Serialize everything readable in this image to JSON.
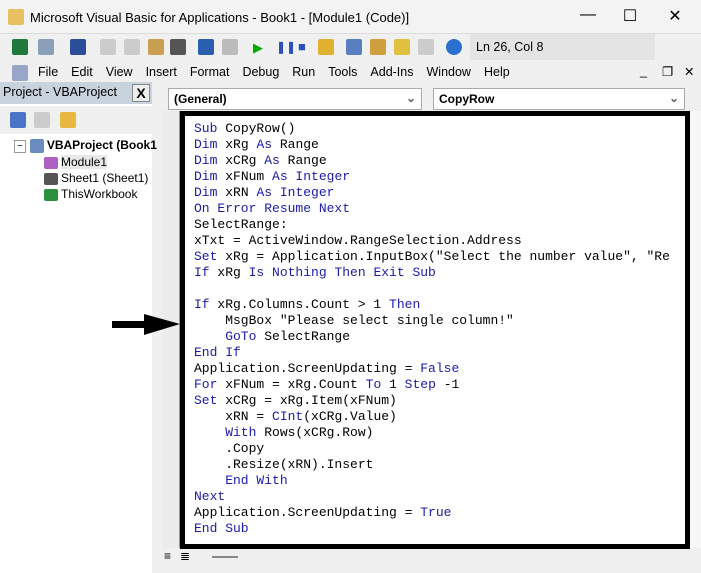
{
  "window": {
    "title": "Microsoft Visual Basic for Applications - Book1 - [Module1 (Code)]",
    "minimize": "—",
    "maximize": "☐",
    "close": "✕"
  },
  "toolbar": {
    "status": "Ln 26, Col 8"
  },
  "menu": [
    "File",
    "Edit",
    "View",
    "Insert",
    "Format",
    "Debug",
    "Run",
    "Tools",
    "Add-Ins",
    "Window",
    "Help"
  ],
  "project": {
    "title": "Project - VBAProject",
    "close": "X",
    "root": "VBAProject (Book1",
    "items": [
      "Module1",
      "Sheet1 (Sheet1)",
      "ThisWorkbook"
    ]
  },
  "combos": {
    "object": "(General)",
    "procedure": "CopyRow"
  },
  "code": [
    [
      [
        "kw",
        "Sub "
      ],
      [
        "id",
        "CopyRow()"
      ]
    ],
    [
      [
        "kw",
        "Dim "
      ],
      [
        "id",
        "xRg "
      ],
      [
        "kw",
        "As "
      ],
      [
        "id",
        "Range"
      ]
    ],
    [
      [
        "kw",
        "Dim "
      ],
      [
        "id",
        "xCRg "
      ],
      [
        "kw",
        "As "
      ],
      [
        "id",
        "Range"
      ]
    ],
    [
      [
        "kw",
        "Dim "
      ],
      [
        "id",
        "xFNum "
      ],
      [
        "kw",
        "As Integer"
      ]
    ],
    [
      [
        "kw",
        "Dim "
      ],
      [
        "id",
        "xRN "
      ],
      [
        "kw",
        "As Integer"
      ]
    ],
    [
      [
        "kw",
        "On Error Resume Next"
      ]
    ],
    [
      [
        "id",
        "SelectRange:"
      ]
    ],
    [
      [
        "id",
        "xTxt = ActiveWindow.RangeSelection.Address"
      ]
    ],
    [
      [
        "kw",
        "Set "
      ],
      [
        "id",
        "xRg = Application.InputBox(\"Select the number value\", \"Re"
      ]
    ],
    [
      [
        "kw",
        "If "
      ],
      [
        "id",
        "xRg "
      ],
      [
        "kw",
        "Is Nothing Then Exit Sub"
      ]
    ],
    [
      [
        "id",
        ""
      ]
    ],
    [
      [
        "kw",
        "If "
      ],
      [
        "id",
        "xRg.Columns.Count > 1 "
      ],
      [
        "kw",
        "Then"
      ]
    ],
    [
      [
        "id",
        "    MsgBox \"Please select single column!\""
      ]
    ],
    [
      [
        "kw",
        "    GoTo "
      ],
      [
        "id",
        "SelectRange"
      ]
    ],
    [
      [
        "kw",
        "End If"
      ]
    ],
    [
      [
        "id",
        "Application.ScreenUpdating = "
      ],
      [
        "kw",
        "False"
      ]
    ],
    [
      [
        "kw",
        "For "
      ],
      [
        "id",
        "xFNum = xRg.Count "
      ],
      [
        "kw",
        "To "
      ],
      [
        "id",
        "1 "
      ],
      [
        "kw",
        "Step "
      ],
      [
        "id",
        "-1"
      ]
    ],
    [
      [
        "kw",
        "Set "
      ],
      [
        "id",
        "xCRg = xRg.Item(xFNum)"
      ]
    ],
    [
      [
        "id",
        "    xRN = "
      ],
      [
        "kw",
        "CInt"
      ],
      [
        "id",
        "(xCRg.Value)"
      ]
    ],
    [
      [
        "kw",
        "    With "
      ],
      [
        "id",
        "Rows(xCRg.Row)"
      ]
    ],
    [
      [
        "id",
        "    .Copy"
      ]
    ],
    [
      [
        "id",
        "    .Resize(xRN).Insert"
      ]
    ],
    [
      [
        "kw",
        "    End With"
      ]
    ],
    [
      [
        "kw",
        "Next"
      ]
    ],
    [
      [
        "id",
        "Application.ScreenUpdating = "
      ],
      [
        "kw",
        "True"
      ]
    ],
    [
      [
        "kw",
        "End Sub"
      ]
    ]
  ]
}
